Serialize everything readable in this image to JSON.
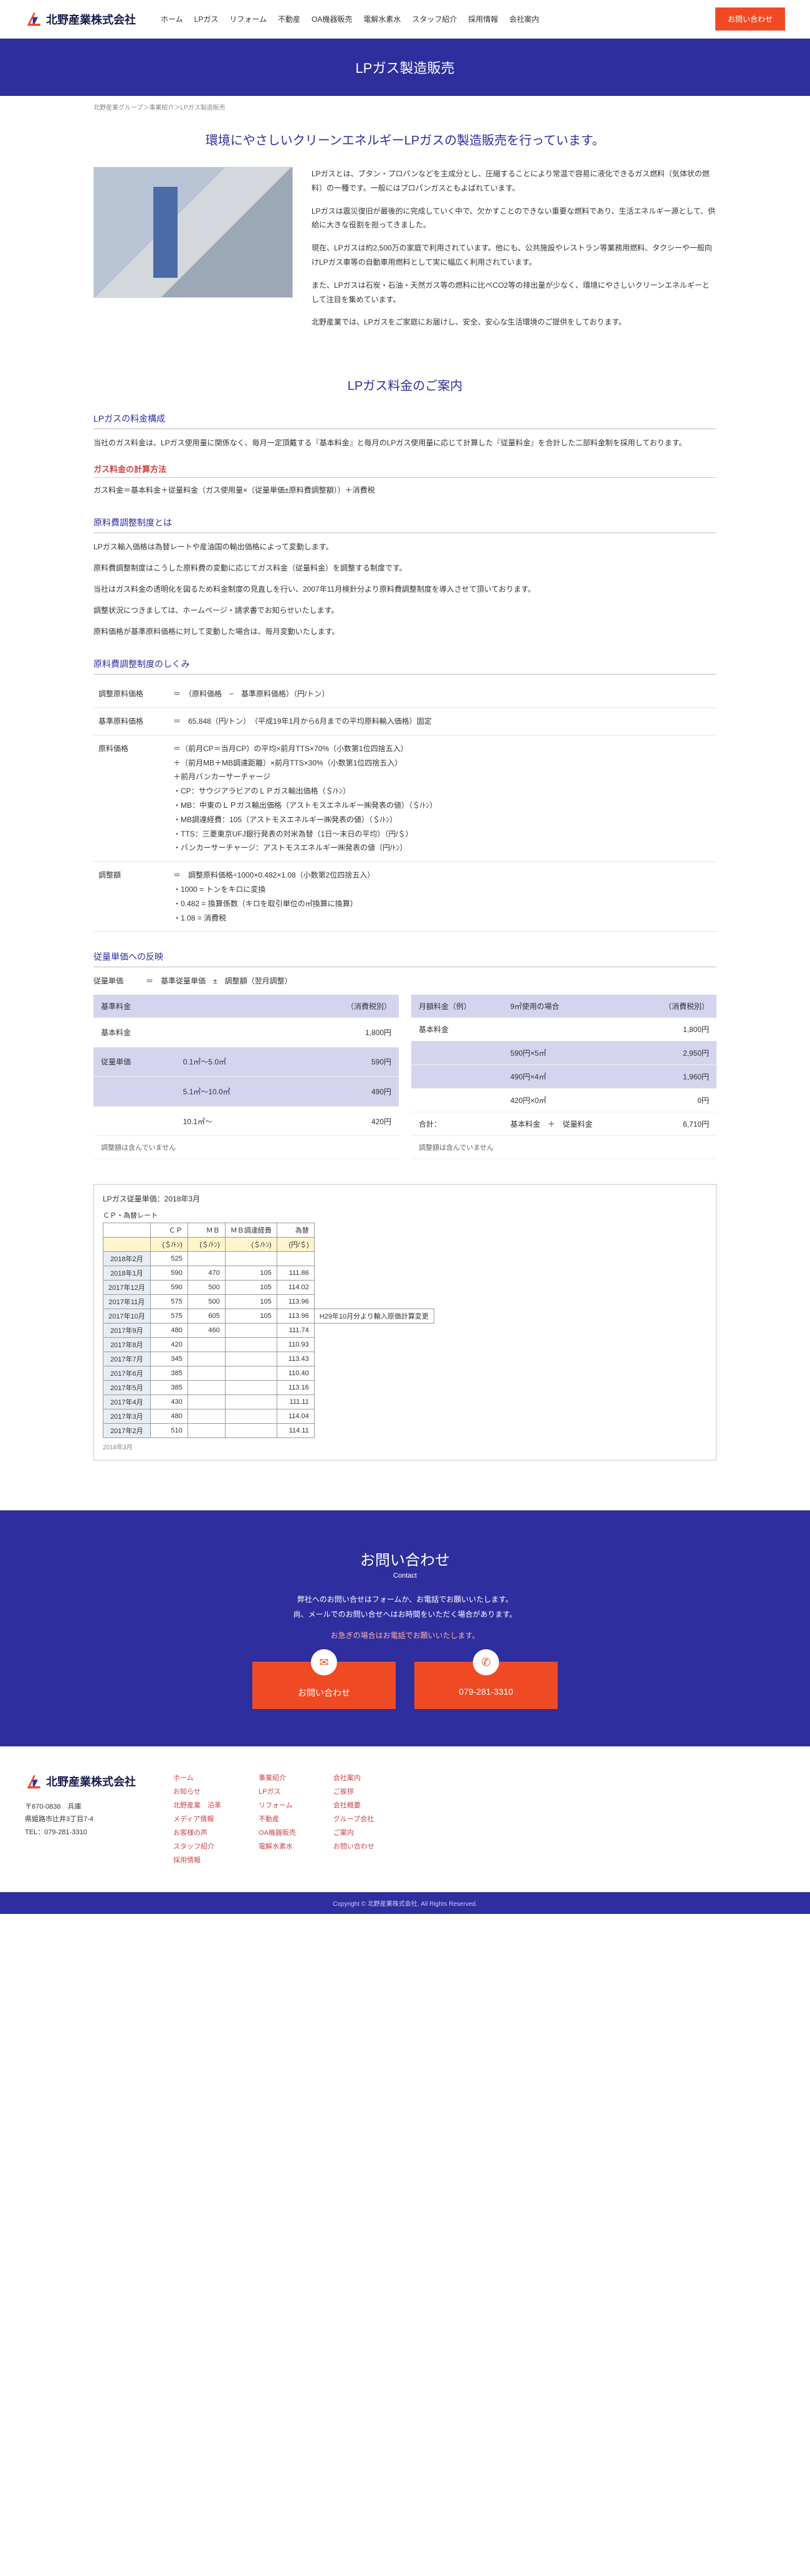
{
  "header": {
    "company": "北野産業株式会社",
    "nav": [
      "ホーム",
      "LPガス",
      "リフォーム",
      "不動産",
      "OA機器販売",
      "電解水素水",
      "スタッフ紹介",
      "採用情報",
      "会社案内"
    ],
    "cta": "お問い合わせ"
  },
  "page_title": "LPガス製造販売",
  "breadcrumb": "北野産業グループ＞事業紹介＞LPガス製造販売",
  "hero": {
    "heading": "環境にやさしいクリーンエネルギーLPガスの製造販売を行っています。",
    "p1": "LPガスとは、ブタン・プロパンなどを主成分とし、圧縮することにより常温で容易に液化できるガス燃料（気体状の燃料）の一種です。一般にはプロパンガスともよばれています。",
    "p2": "LPガスは震災復旧が最後的に完成していく中で、欠かすことのできない重要な燃料であり、生活エネルギー源として、供給に大きな役割を担ってきました。",
    "p3": "現在、LPガスは約2,500万の家庭で利用されています。他にも、公共施設やレストラン等業務用燃料、タクシーや一般向けLPガス車等の自動車用燃料として実に幅広く利用されています。",
    "p4": "また、LPガスは石炭・石油・天然ガス等の燃料に比べCO2等の排出量が少なく、環境にやさしいクリーンエネルギーとして注目を集めています。",
    "p5": "北野産業では、LPガスをご家庭にお届けし、安全、安心な生活環境のご提供をしております。"
  },
  "pricing_h": "LPガス料金のご案内",
  "sub1": "LPガスの料金構成",
  "sub1_p": "当社のガス料金は、LPガス使用量に関係なく、毎月一定頂戴する『基本料金』と毎月のLPガス使用量に応じて計算した『従量料金』を合計した二部料金制を採用しております。",
  "sub2": "ガス料金の計算方法",
  "sub2_p": "ガス料金＝基本料金＋従量料金（ガス使用量×（従量単価±原料費調整額））＋消費税",
  "sub3": "原料費調整制度とは",
  "sub3_p1": "LPガス輸入価格は為替レートや産油国の輸出価格によって変動します。",
  "sub3_p2": "原料費調整制度はこうした原料費の変動に応じてガス料金（従量料金）を調整する制度です。",
  "sub3_p3": "当社はガス料金の透明化を図るため料金制度の見直しを行い、2007年11月検針分より原料費調整制度を導入させて頂いております。",
  "sub3_p4": "調整状況につきましては、ホームページ・請求書でお知らせいたします。",
  "sub3_p5": "原料価格が基準原料価格に対して変動した場合は、毎月変動いたします。",
  "sub4": "原料費調整制度のしくみ",
  "mech": {
    "rows": [
      {
        "k": "調整原料価格",
        "v": "＝　（原料価格　−　基準原料価格）（円/トン）"
      },
      {
        "k": "基準原料価格",
        "v": "＝　65,848（円/トン）　（平成19年1月から6月までの平均原料輸入価格）固定"
      },
      {
        "k": "原料価格",
        "v": "＝（前月CP＝当月CP）の平均×前月TTS×70%（小数第1位四捨五入）\n＋（前月MB＋MB調達距離）×前月TTS×30%（小数第1位四捨五入）\n＋前月バンカーサーチャージ\n・CP：サウジアラビアのＬＰガス輸出価格（＄/ﾄﾝ）\n・MB：中東のＬＰガス輸出価格（アストモスエネルギー㈱発表の値）（＄/ﾄﾝ）\n・MB調達経費：105（アストモスエネルギー㈱発表の値）（＄/ﾄﾝ）\n・TTS：三菱東京UFJ銀行発表の対米為替（1日〜末日の平均）（円/＄）\n・バンカーサーチャージ：アストモスエネルギー㈱発表の値（円/ﾄﾝ）"
      },
      {
        "k": "調整額",
        "v": "＝　調整原料価格÷1000×0.482×1.08（小数第2位四捨五入）\n・1000 = トンをキロに変換\n・0.482 = 換算係数（キロを取引単位の㎥換算に換算）\n・1.08 = 消費税"
      }
    ]
  },
  "sub5": "従量単価への反映",
  "sub5_formula": "従量単価　　　＝　基準従量単価　±　調整額（翌月調整）",
  "table1": {
    "head": [
      "基準料金",
      "",
      "（消費税別）"
    ],
    "rows": [
      [
        "基本料金",
        "",
        "1,800円"
      ],
      [
        "従量単価",
        "0.1㎥〜5.0㎥",
        "590円"
      ],
      [
        "",
        "5.1㎥〜10.0㎥",
        "490円"
      ],
      [
        "",
        "10.1㎥〜",
        "420円"
      ]
    ],
    "note": "調整額は含んでいません"
  },
  "table2": {
    "head": [
      "月額料金（例）",
      "9㎥使用の場合",
      "（消費税別）"
    ],
    "rows": [
      [
        "基本料金",
        "",
        "1,800円"
      ],
      [
        "",
        "590円×5㎥",
        "2,950円"
      ],
      [
        "",
        "490円×4㎥",
        "1,960円"
      ],
      [
        "",
        "420円×0㎥",
        "0円"
      ],
      [
        "合計：",
        "基本料金　＋　従量料金",
        "6,710円"
      ]
    ],
    "note": "調整額は含んでいません"
  },
  "rates": {
    "title": "LPガス従量単価：2018年3月",
    "section": "ＣＰ・為替レート",
    "head": [
      "",
      "ＣＰ",
      "ＭＢ",
      "ＭＢ調達経費",
      "為替"
    ],
    "unit": [
      "",
      "(＄/ﾄﾝ)",
      "(＄/ﾄﾝ)",
      "(＄/ﾄﾝ)",
      "(円/＄)"
    ],
    "rows": [
      [
        "2018年2月",
        "525",
        "",
        "",
        ""
      ],
      [
        "2018年1月",
        "590",
        "470",
        "105",
        "111.86"
      ],
      [
        "2017年12月",
        "590",
        "500",
        "105",
        "114.02"
      ],
      [
        "2017年11月",
        "575",
        "500",
        "105",
        "113.96"
      ],
      [
        "2017年10月",
        "575",
        "605",
        "105",
        "113.96",
        "H29年10月分より輸入原価計算変更"
      ],
      [
        "2017年9月",
        "480",
        "460",
        "",
        "111.74"
      ],
      [
        "2017年8月",
        "420",
        "",
        "",
        "110.93"
      ],
      [
        "2017年7月",
        "345",
        "",
        "",
        "113.43"
      ],
      [
        "2017年6月",
        "385",
        "",
        "",
        "110.40"
      ],
      [
        "2017年5月",
        "385",
        "",
        "",
        "113.16"
      ],
      [
        "2017年4月",
        "430",
        "",
        "",
        "111.11"
      ],
      [
        "2017年3月",
        "480",
        "",
        "",
        "114.04"
      ],
      [
        "2017年2月",
        "510",
        "",
        "",
        "114.11"
      ]
    ],
    "footer_row": "2018年3月"
  },
  "contact": {
    "h": "お問い合わせ",
    "sub": "Contact",
    "p1": "弊社へのお問い合せはフォームか、お電話でお願いいたします。",
    "p2": "尚、メールでのお問い合せへはお時間をいただく場合があります。",
    "urgent": "お急ぎの場合はお電話でお願いいたします。",
    "btn1": "お問い合わせ",
    "btn2": "079-281-3310"
  },
  "footer": {
    "company": "北野産業株式会社",
    "addr1": "〒670-0836　兵庫",
    "addr2": "県姫路市辻井3丁目7-4",
    "tel": "TEL：079-281-3310",
    "cols": [
      [
        "ホーム",
        "お知らせ",
        "北野産業　沿革",
        "メディア情報",
        "お客様の声",
        "スタッフ紹介",
        "採用情報"
      ],
      [
        "事業紹介",
        "LPガス",
        "リフォーム",
        "不動産",
        "OA機器販売",
        "電解水素水"
      ],
      [
        "会社案内",
        "ご挨拶",
        "会社概要",
        "グループ会社",
        "ご案内",
        "お問い合わせ"
      ]
    ],
    "copyright": "Copyright © 北野産業株式会社. All Rights Reserved."
  }
}
